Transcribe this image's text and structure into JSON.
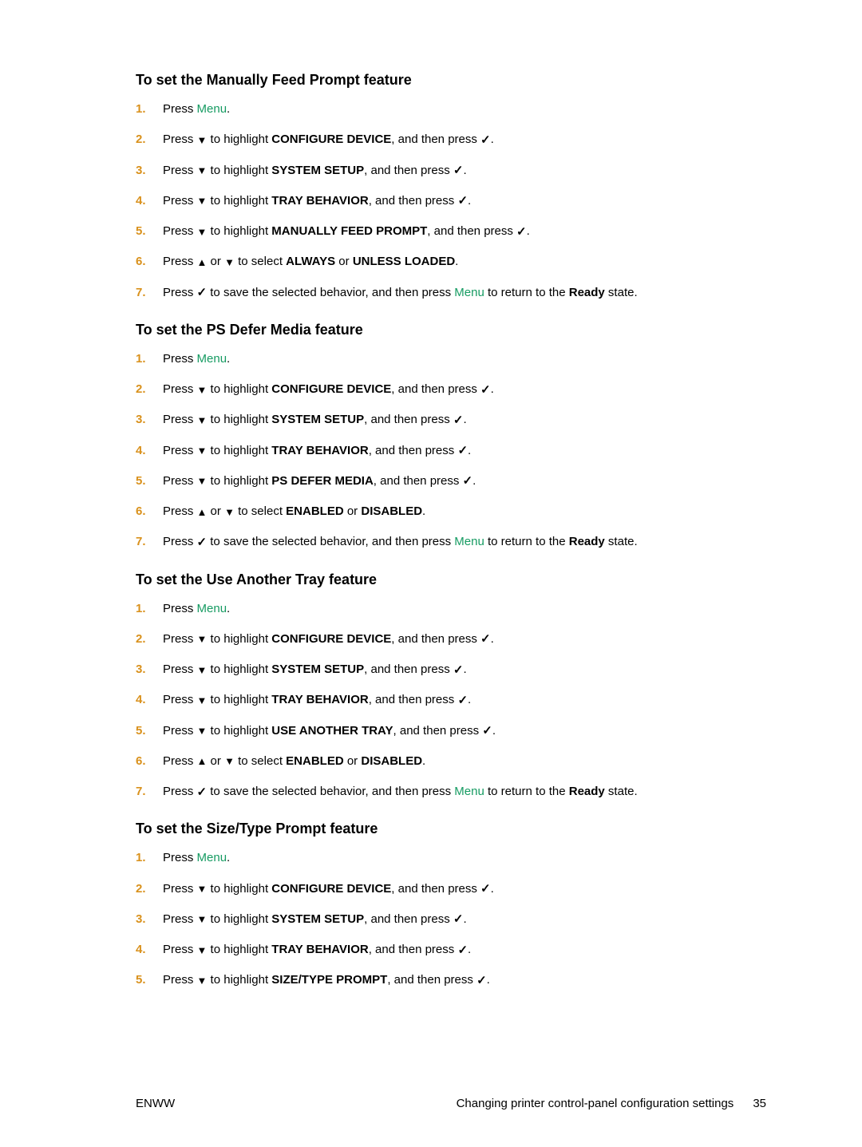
{
  "sections": [
    {
      "heading": "To set the Manually Feed Prompt feature",
      "steps": [
        [
          {
            "t": "text",
            "v": "Press "
          },
          {
            "t": "menu",
            "v": "Menu"
          },
          {
            "t": "text",
            "v": "."
          }
        ],
        [
          {
            "t": "text",
            "v": "Press "
          },
          {
            "t": "down"
          },
          {
            "t": "text",
            "v": " to highlight "
          },
          {
            "t": "bold",
            "v": "CONFIGURE DEVICE"
          },
          {
            "t": "text",
            "v": ", and then press "
          },
          {
            "t": "check"
          },
          {
            "t": "text",
            "v": "."
          }
        ],
        [
          {
            "t": "text",
            "v": "Press "
          },
          {
            "t": "down"
          },
          {
            "t": "text",
            "v": " to highlight "
          },
          {
            "t": "bold",
            "v": "SYSTEM SETUP"
          },
          {
            "t": "text",
            "v": ", and then press "
          },
          {
            "t": "check"
          },
          {
            "t": "text",
            "v": "."
          }
        ],
        [
          {
            "t": "text",
            "v": "Press "
          },
          {
            "t": "down"
          },
          {
            "t": "text",
            "v": " to highlight "
          },
          {
            "t": "bold",
            "v": "TRAY BEHAVIOR"
          },
          {
            "t": "text",
            "v": ", and then press "
          },
          {
            "t": "check"
          },
          {
            "t": "text",
            "v": "."
          }
        ],
        [
          {
            "t": "text",
            "v": "Press "
          },
          {
            "t": "down"
          },
          {
            "t": "text",
            "v": " to highlight "
          },
          {
            "t": "bold",
            "v": "MANUALLY FEED PROMPT"
          },
          {
            "t": "text",
            "v": ", and then press "
          },
          {
            "t": "check"
          },
          {
            "t": "text",
            "v": "."
          }
        ],
        [
          {
            "t": "text",
            "v": "Press "
          },
          {
            "t": "up"
          },
          {
            "t": "text",
            "v": " or "
          },
          {
            "t": "down"
          },
          {
            "t": "text",
            "v": " to select "
          },
          {
            "t": "bold",
            "v": "ALWAYS"
          },
          {
            "t": "text",
            "v": " or "
          },
          {
            "t": "bold",
            "v": "UNLESS LOADED"
          },
          {
            "t": "text",
            "v": "."
          }
        ],
        [
          {
            "t": "text",
            "v": "Press "
          },
          {
            "t": "check"
          },
          {
            "t": "text",
            "v": " to save the selected behavior, and then press "
          },
          {
            "t": "menu",
            "v": "Menu"
          },
          {
            "t": "text",
            "v": " to return to the "
          },
          {
            "t": "bold",
            "v": "Ready"
          },
          {
            "t": "text",
            "v": " state."
          }
        ]
      ]
    },
    {
      "heading": "To set the PS Defer Media feature",
      "steps": [
        [
          {
            "t": "text",
            "v": "Press "
          },
          {
            "t": "menu",
            "v": "Menu"
          },
          {
            "t": "text",
            "v": "."
          }
        ],
        [
          {
            "t": "text",
            "v": "Press "
          },
          {
            "t": "down"
          },
          {
            "t": "text",
            "v": " to highlight "
          },
          {
            "t": "bold",
            "v": "CONFIGURE DEVICE"
          },
          {
            "t": "text",
            "v": ", and then press "
          },
          {
            "t": "check"
          },
          {
            "t": "text",
            "v": "."
          }
        ],
        [
          {
            "t": "text",
            "v": "Press "
          },
          {
            "t": "down"
          },
          {
            "t": "text",
            "v": " to highlight "
          },
          {
            "t": "bold",
            "v": "SYSTEM SETUP"
          },
          {
            "t": "text",
            "v": ", and then press "
          },
          {
            "t": "check"
          },
          {
            "t": "text",
            "v": "."
          }
        ],
        [
          {
            "t": "text",
            "v": "Press "
          },
          {
            "t": "down"
          },
          {
            "t": "text",
            "v": " to highlight "
          },
          {
            "t": "bold",
            "v": "TRAY BEHAVIOR"
          },
          {
            "t": "text",
            "v": ", and then press "
          },
          {
            "t": "check"
          },
          {
            "t": "text",
            "v": "."
          }
        ],
        [
          {
            "t": "text",
            "v": "Press "
          },
          {
            "t": "down"
          },
          {
            "t": "text",
            "v": " to highlight "
          },
          {
            "t": "bold",
            "v": "PS DEFER MEDIA"
          },
          {
            "t": "text",
            "v": ", and then press "
          },
          {
            "t": "check"
          },
          {
            "t": "text",
            "v": "."
          }
        ],
        [
          {
            "t": "text",
            "v": "Press "
          },
          {
            "t": "up"
          },
          {
            "t": "text",
            "v": " or "
          },
          {
            "t": "down"
          },
          {
            "t": "text",
            "v": " to select "
          },
          {
            "t": "bold",
            "v": "ENABLED"
          },
          {
            "t": "text",
            "v": " or "
          },
          {
            "t": "bold",
            "v": "DISABLED"
          },
          {
            "t": "text",
            "v": "."
          }
        ],
        [
          {
            "t": "text",
            "v": "Press "
          },
          {
            "t": "check"
          },
          {
            "t": "text",
            "v": " to save the selected behavior, and then press "
          },
          {
            "t": "menu",
            "v": "Menu"
          },
          {
            "t": "text",
            "v": " to return to the "
          },
          {
            "t": "bold",
            "v": "Ready"
          },
          {
            "t": "text",
            "v": " state."
          }
        ]
      ]
    },
    {
      "heading": "To set the Use Another Tray feature",
      "steps": [
        [
          {
            "t": "text",
            "v": "Press "
          },
          {
            "t": "menu",
            "v": "Menu"
          },
          {
            "t": "text",
            "v": "."
          }
        ],
        [
          {
            "t": "text",
            "v": "Press "
          },
          {
            "t": "down"
          },
          {
            "t": "text",
            "v": " to highlight "
          },
          {
            "t": "bold",
            "v": "CONFIGURE DEVICE"
          },
          {
            "t": "text",
            "v": ", and then press "
          },
          {
            "t": "check"
          },
          {
            "t": "text",
            "v": "."
          }
        ],
        [
          {
            "t": "text",
            "v": "Press "
          },
          {
            "t": "down"
          },
          {
            "t": "text",
            "v": " to highlight "
          },
          {
            "t": "bold",
            "v": "SYSTEM SETUP"
          },
          {
            "t": "text",
            "v": ", and then press "
          },
          {
            "t": "check"
          },
          {
            "t": "text",
            "v": "."
          }
        ],
        [
          {
            "t": "text",
            "v": "Press "
          },
          {
            "t": "down"
          },
          {
            "t": "text",
            "v": " to highlight "
          },
          {
            "t": "bold",
            "v": "TRAY BEHAVIOR"
          },
          {
            "t": "text",
            "v": ", and then press "
          },
          {
            "t": "check"
          },
          {
            "t": "text",
            "v": "."
          }
        ],
        [
          {
            "t": "text",
            "v": "Press "
          },
          {
            "t": "down"
          },
          {
            "t": "text",
            "v": " to highlight "
          },
          {
            "t": "bold",
            "v": "USE ANOTHER TRAY"
          },
          {
            "t": "text",
            "v": ", and then press "
          },
          {
            "t": "check"
          },
          {
            "t": "text",
            "v": "."
          }
        ],
        [
          {
            "t": "text",
            "v": "Press "
          },
          {
            "t": "up"
          },
          {
            "t": "text",
            "v": " or "
          },
          {
            "t": "down"
          },
          {
            "t": "text",
            "v": " to select "
          },
          {
            "t": "bold",
            "v": "ENABLED"
          },
          {
            "t": "text",
            "v": " or "
          },
          {
            "t": "bold",
            "v": "DISABLED"
          },
          {
            "t": "text",
            "v": "."
          }
        ],
        [
          {
            "t": "text",
            "v": "Press "
          },
          {
            "t": "check"
          },
          {
            "t": "text",
            "v": " to save the selected behavior, and then press "
          },
          {
            "t": "menu",
            "v": "Menu"
          },
          {
            "t": "text",
            "v": " to return to the "
          },
          {
            "t": "bold",
            "v": "Ready"
          },
          {
            "t": "text",
            "v": " state."
          }
        ]
      ]
    },
    {
      "heading": "To set the Size/Type Prompt feature",
      "steps": [
        [
          {
            "t": "text",
            "v": "Press "
          },
          {
            "t": "menu",
            "v": "Menu"
          },
          {
            "t": "text",
            "v": "."
          }
        ],
        [
          {
            "t": "text",
            "v": "Press "
          },
          {
            "t": "down"
          },
          {
            "t": "text",
            "v": " to highlight "
          },
          {
            "t": "bold",
            "v": "CONFIGURE DEVICE"
          },
          {
            "t": "text",
            "v": ", and then press "
          },
          {
            "t": "check"
          },
          {
            "t": "text",
            "v": "."
          }
        ],
        [
          {
            "t": "text",
            "v": "Press "
          },
          {
            "t": "down"
          },
          {
            "t": "text",
            "v": " to highlight "
          },
          {
            "t": "bold",
            "v": "SYSTEM SETUP"
          },
          {
            "t": "text",
            "v": ", and then press "
          },
          {
            "t": "check"
          },
          {
            "t": "text",
            "v": "."
          }
        ],
        [
          {
            "t": "text",
            "v": "Press "
          },
          {
            "t": "down"
          },
          {
            "t": "text",
            "v": " to highlight "
          },
          {
            "t": "bold",
            "v": "TRAY BEHAVIOR"
          },
          {
            "t": "text",
            "v": ", and then press "
          },
          {
            "t": "check"
          },
          {
            "t": "text",
            "v": "."
          }
        ],
        [
          {
            "t": "text",
            "v": "Press "
          },
          {
            "t": "down"
          },
          {
            "t": "text",
            "v": " to highlight "
          },
          {
            "t": "bold",
            "v": "SIZE/TYPE PROMPT"
          },
          {
            "t": "text",
            "v": ", and then press "
          },
          {
            "t": "check"
          },
          {
            "t": "text",
            "v": "."
          }
        ]
      ]
    }
  ],
  "footer": {
    "left": "ENWW",
    "right_text": "Changing printer control-panel configuration settings",
    "page": "35"
  }
}
